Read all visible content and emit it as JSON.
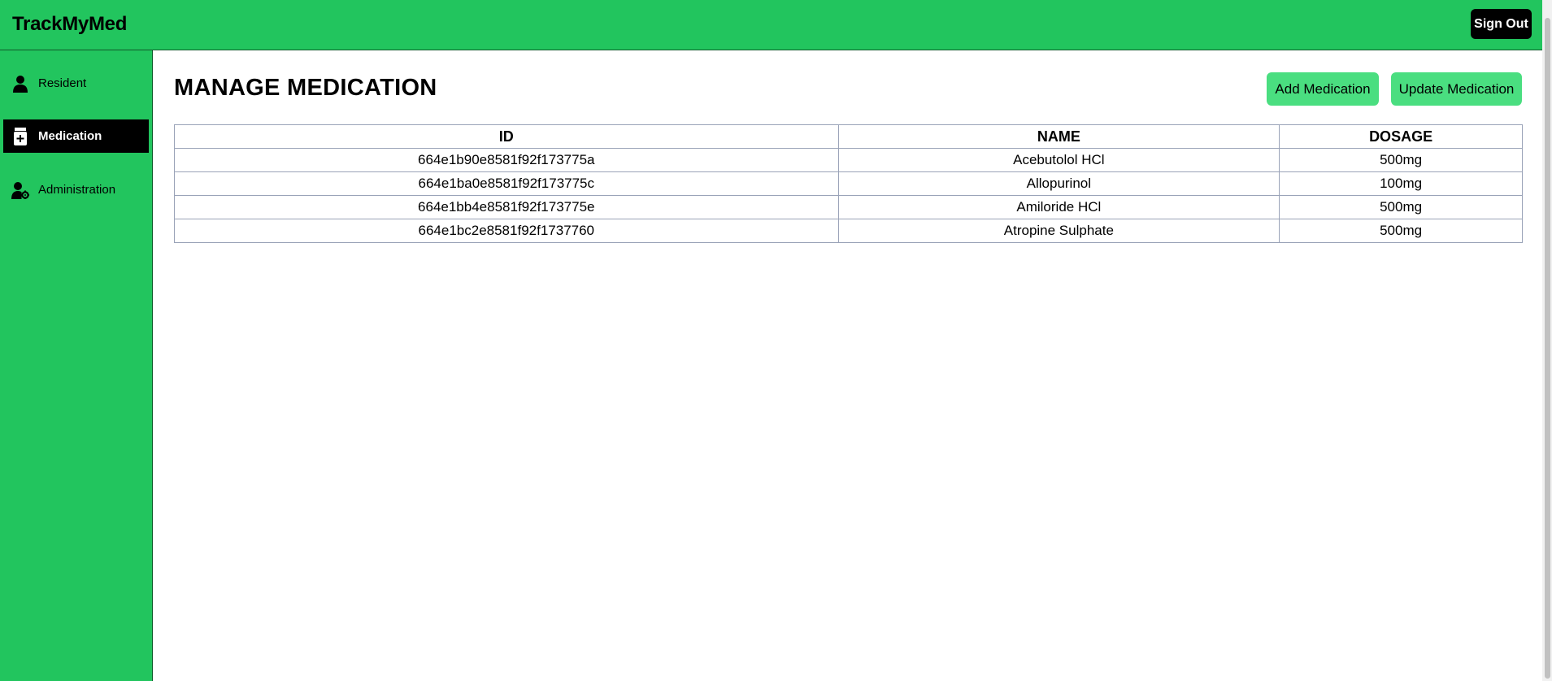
{
  "header": {
    "brand": "TrackMyMed",
    "signout_label": "Sign Out"
  },
  "sidebar": {
    "items": [
      {
        "label": "Resident",
        "icon": "person-icon",
        "active": false
      },
      {
        "label": "Medication",
        "icon": "medicine-bottle-icon",
        "active": true
      },
      {
        "label": "Administration",
        "icon": "user-gear-icon",
        "active": false
      }
    ]
  },
  "main": {
    "title": "MANAGE MEDICATION",
    "add_label": "Add Medication",
    "update_label": "Update Medication",
    "table": {
      "columns": [
        "ID",
        "NAME",
        "DOSAGE"
      ],
      "rows": [
        [
          "664e1b90e8581f92f173775a",
          "Acebutolol HCl",
          "500mg"
        ],
        [
          "664e1ba0e8581f92f173775c",
          "Allopurinol",
          "100mg"
        ],
        [
          "664e1bb4e8581f92f173775e",
          "Amiloride HCl",
          "500mg"
        ],
        [
          "664e1bc2e8581f92f1737760",
          "Atropine Sulphate",
          "500mg"
        ]
      ]
    }
  },
  "colors": {
    "brand_green": "#22c55e",
    "button_green": "#4ade80",
    "active_nav": "#000000"
  }
}
